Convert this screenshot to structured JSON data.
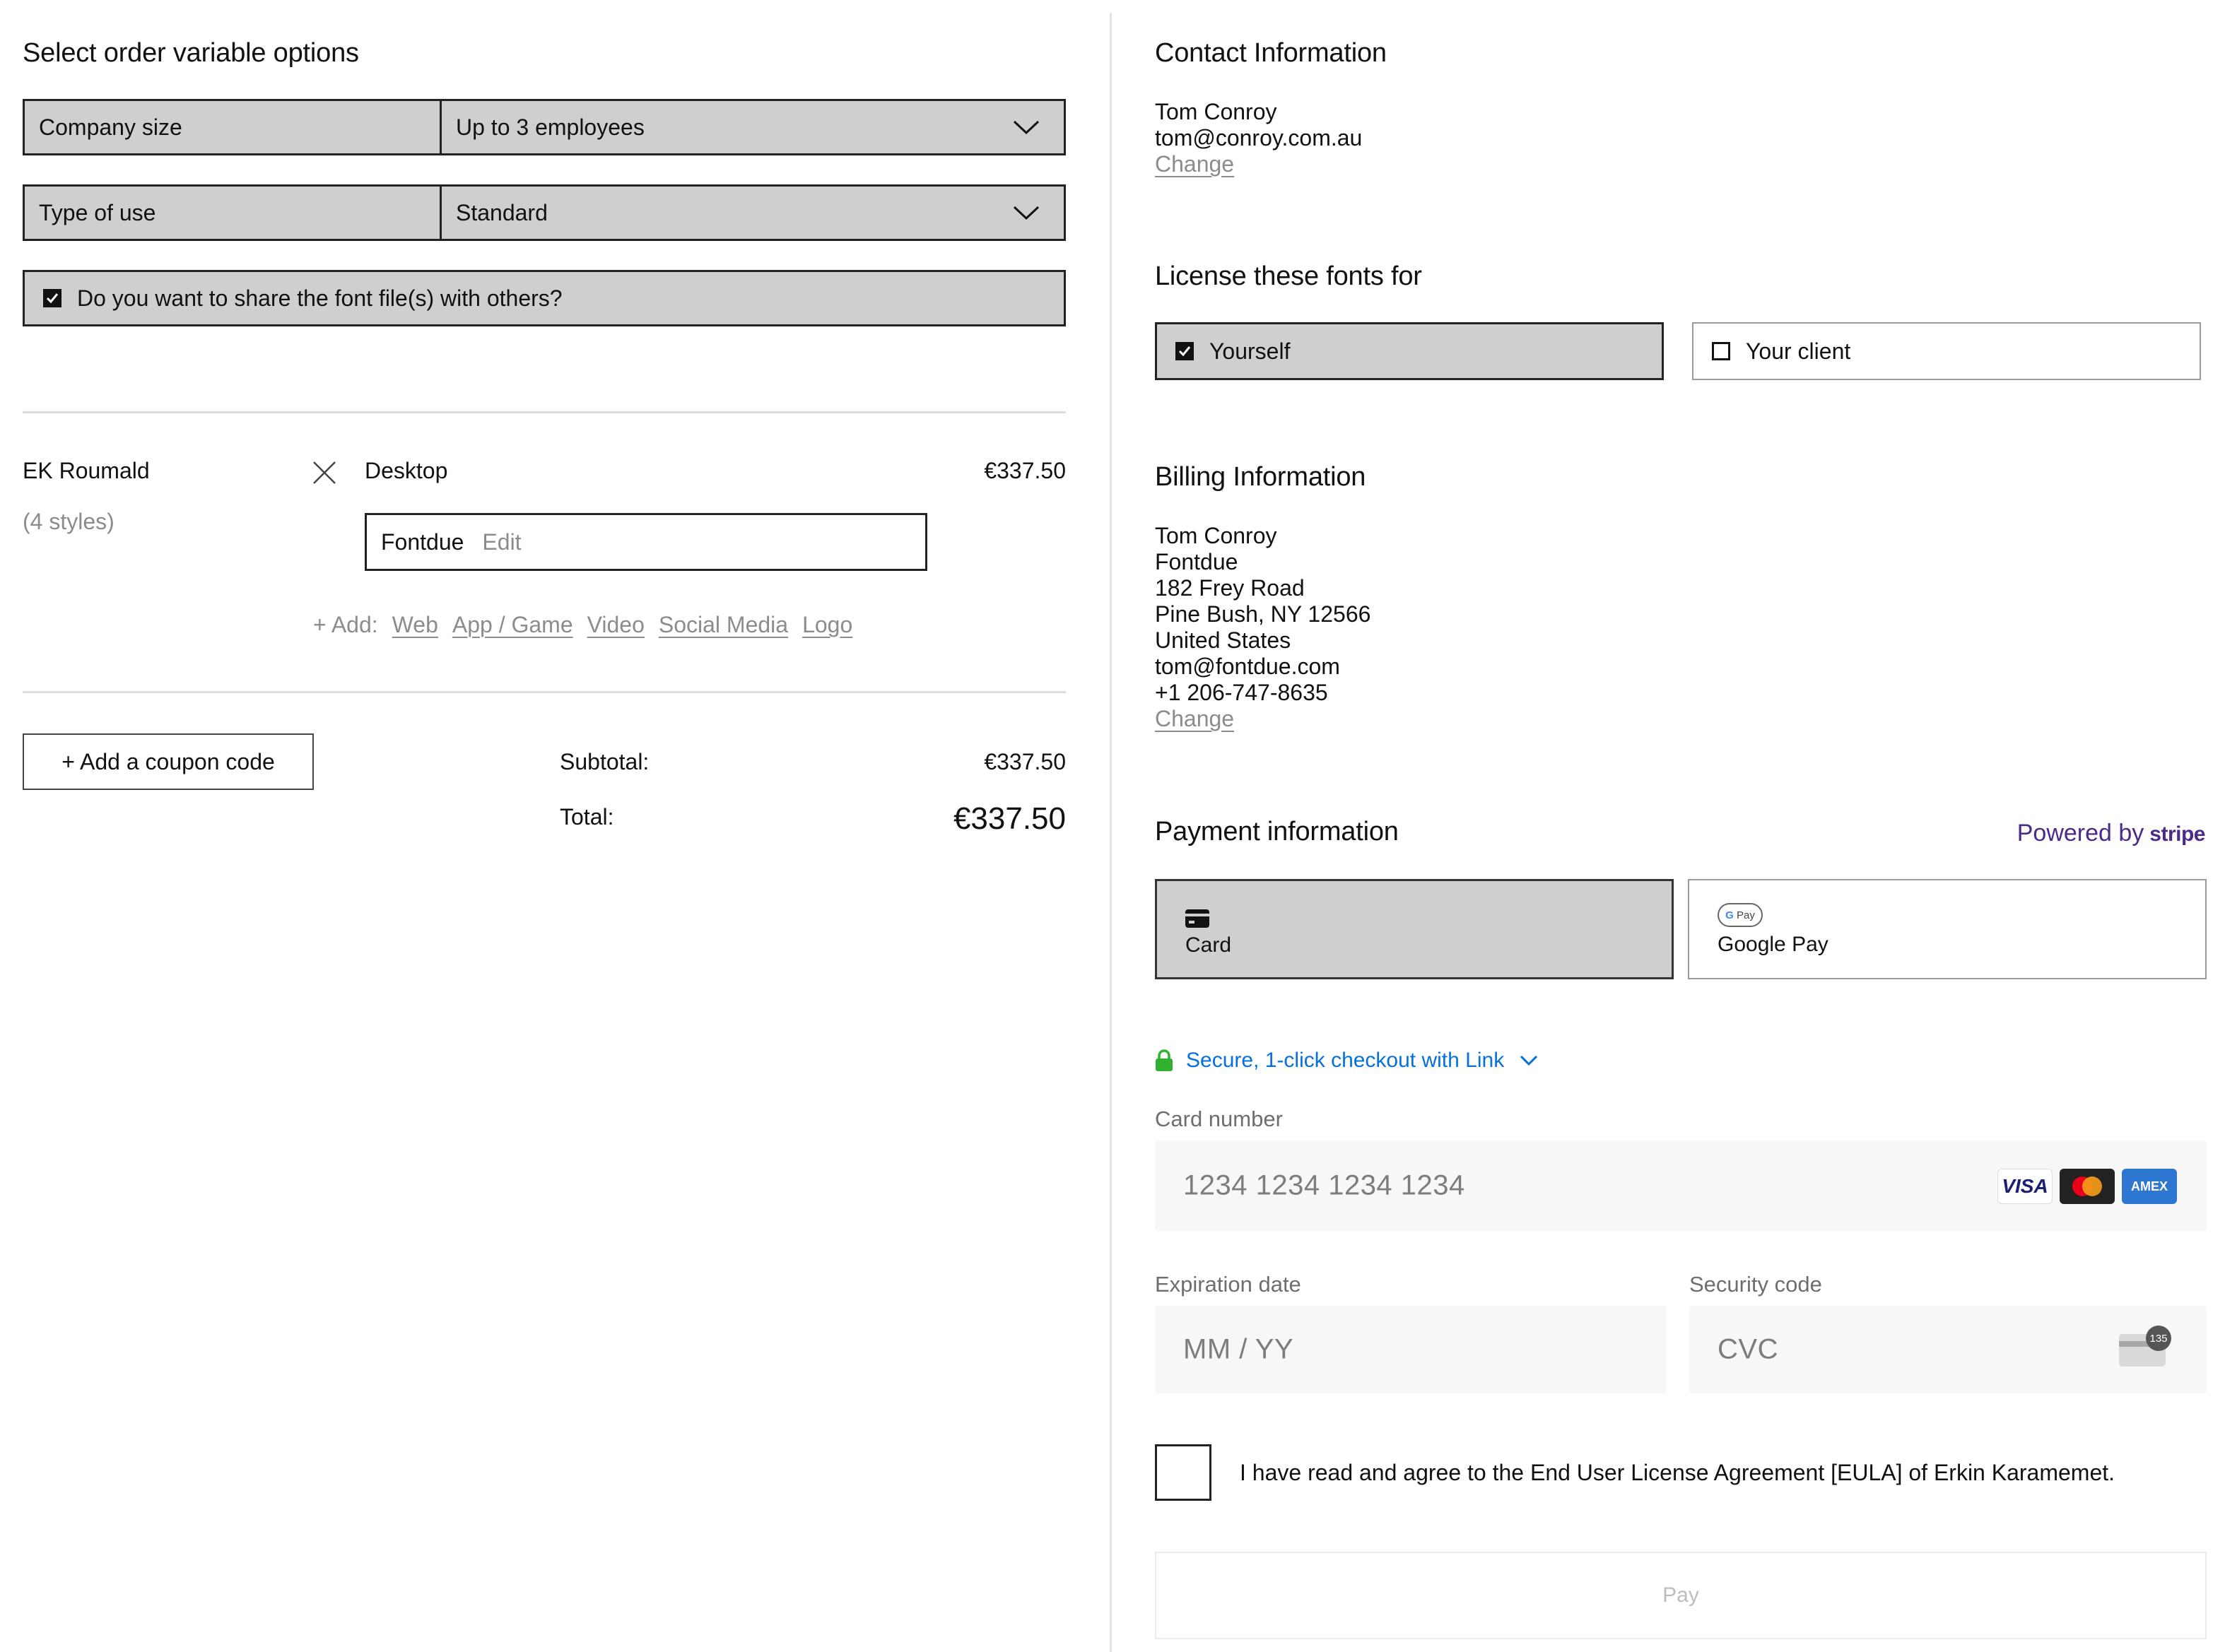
{
  "order_options": {
    "title": "Select order variable options",
    "company_size": {
      "label": "Company size",
      "value": "Up to 3 employees"
    },
    "type_of_use": {
      "label": "Type of use",
      "value": "Standard"
    },
    "share_files": {
      "label": "Do you want to share the font file(s) with others?",
      "checked": true
    }
  },
  "cart_item": {
    "font_name": "EK Roumald",
    "styles": "(4 styles)",
    "license": "Desktop",
    "price": "€337.50",
    "licensee": "Fontdue",
    "edit_label": "Edit",
    "add_prefix": "+ Add:",
    "add_options": [
      "Web",
      "App / Game",
      "Video",
      "Social Media",
      "Logo"
    ]
  },
  "coupon": {
    "button_label": "+ Add a coupon code"
  },
  "totals": {
    "subtotal_label": "Subtotal:",
    "subtotal_value": "€337.50",
    "total_label": "Total:",
    "total_value": "€337.50"
  },
  "contact": {
    "title": "Contact Information",
    "name": "Tom Conroy",
    "email": "tom@conroy.com.au",
    "change_label": "Change"
  },
  "license_for": {
    "title": "License these fonts for",
    "options": [
      {
        "label": "Yourself",
        "checked": true
      },
      {
        "label": "Your client",
        "checked": false
      }
    ]
  },
  "billing": {
    "title": "Billing Information",
    "lines": [
      "Tom Conroy",
      "Fontdue",
      "182 Frey Road",
      "Pine Bush, NY 12566",
      "United States",
      "tom@fontdue.com",
      "+1 206-747-8635"
    ],
    "change_label": "Change"
  },
  "payment": {
    "title": "Payment information",
    "powered_by": "Powered by",
    "powered_brand": "stripe",
    "methods": [
      {
        "label": "Card",
        "icon": "credit-card-icon",
        "selected": true
      },
      {
        "label": "Google Pay",
        "icon": "google-pay-icon",
        "selected": false
      }
    ],
    "link_text": "Secure, 1-click checkout with Link",
    "card_number": {
      "label": "Card number",
      "placeholder": "1234 1234 1234 1234"
    },
    "card_brands": [
      "VISA",
      "mastercard",
      "AMEX"
    ],
    "expiry": {
      "label": "Expiration date",
      "placeholder": "MM / YY"
    },
    "cvc": {
      "label": "Security code",
      "placeholder": "CVC",
      "badge": "135"
    },
    "eula_text": "I have read and agree to the End User License Agreement [EULA] of Erkin Karamemet.",
    "eula_checked": false,
    "pay_label": "Pay"
  },
  "colors": {
    "selected_fill": "#cfcfcf",
    "link_blue": "#0570de",
    "stripe_purple": "#4b2a8a",
    "lock_green": "#30b130"
  }
}
